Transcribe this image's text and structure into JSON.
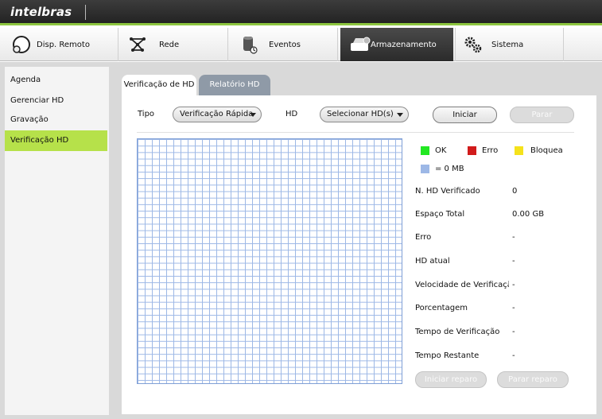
{
  "brand": {
    "logo": "intelbras"
  },
  "nav": {
    "items": [
      {
        "label": "Disp. Remoto",
        "icon": "globe-icon"
      },
      {
        "label": "Rede",
        "icon": "network-icon"
      },
      {
        "label": "Eventos",
        "icon": "events-icon"
      },
      {
        "label": "Armazenamento",
        "icon": "storage-icon",
        "active": true
      },
      {
        "label": "Sistema",
        "icon": "gear-icon"
      }
    ]
  },
  "sidebar": {
    "items": [
      {
        "label": "Agenda"
      },
      {
        "label": "Gerenciar HD"
      },
      {
        "label": "Gravação"
      },
      {
        "label": "Verificação HD",
        "active": true
      }
    ]
  },
  "tabs": [
    {
      "label": "Verificação de HD",
      "active": true
    },
    {
      "label": "Relatório HD"
    }
  ],
  "form": {
    "tipo_label": "Tipo",
    "tipo_value": "Verificação Rápida",
    "hd_label": "HD",
    "hd_value": "Selecionar HD(s)",
    "start_label": "Iniciar",
    "stop_label": "Parar"
  },
  "legend": {
    "ok": {
      "label": "OK",
      "color": "#22e822"
    },
    "erro": {
      "label": "Erro",
      "color": "#d11b1b"
    },
    "bloqueado": {
      "label": "Bloquea",
      "color": "#f5e21b"
    },
    "block": {
      "label": "= 0 MB",
      "color": "#9db8e6"
    }
  },
  "info": [
    {
      "label": "N. HD Verificado",
      "value": "0"
    },
    {
      "label": "Espaço Total",
      "value": "0.00 GB"
    },
    {
      "label": "Erro",
      "value": "-"
    },
    {
      "label": "HD atual",
      "value": "-"
    },
    {
      "label": "Velocidade de Verificação",
      "value": "-"
    },
    {
      "label": "Porcentagem",
      "value": "-"
    },
    {
      "label": "Tempo de Verificação",
      "value": "-"
    },
    {
      "label": "Tempo Restante",
      "value": "-"
    }
  ],
  "repair": {
    "start_label": "Iniciar reparo",
    "stop_label": "Parar reparo"
  }
}
